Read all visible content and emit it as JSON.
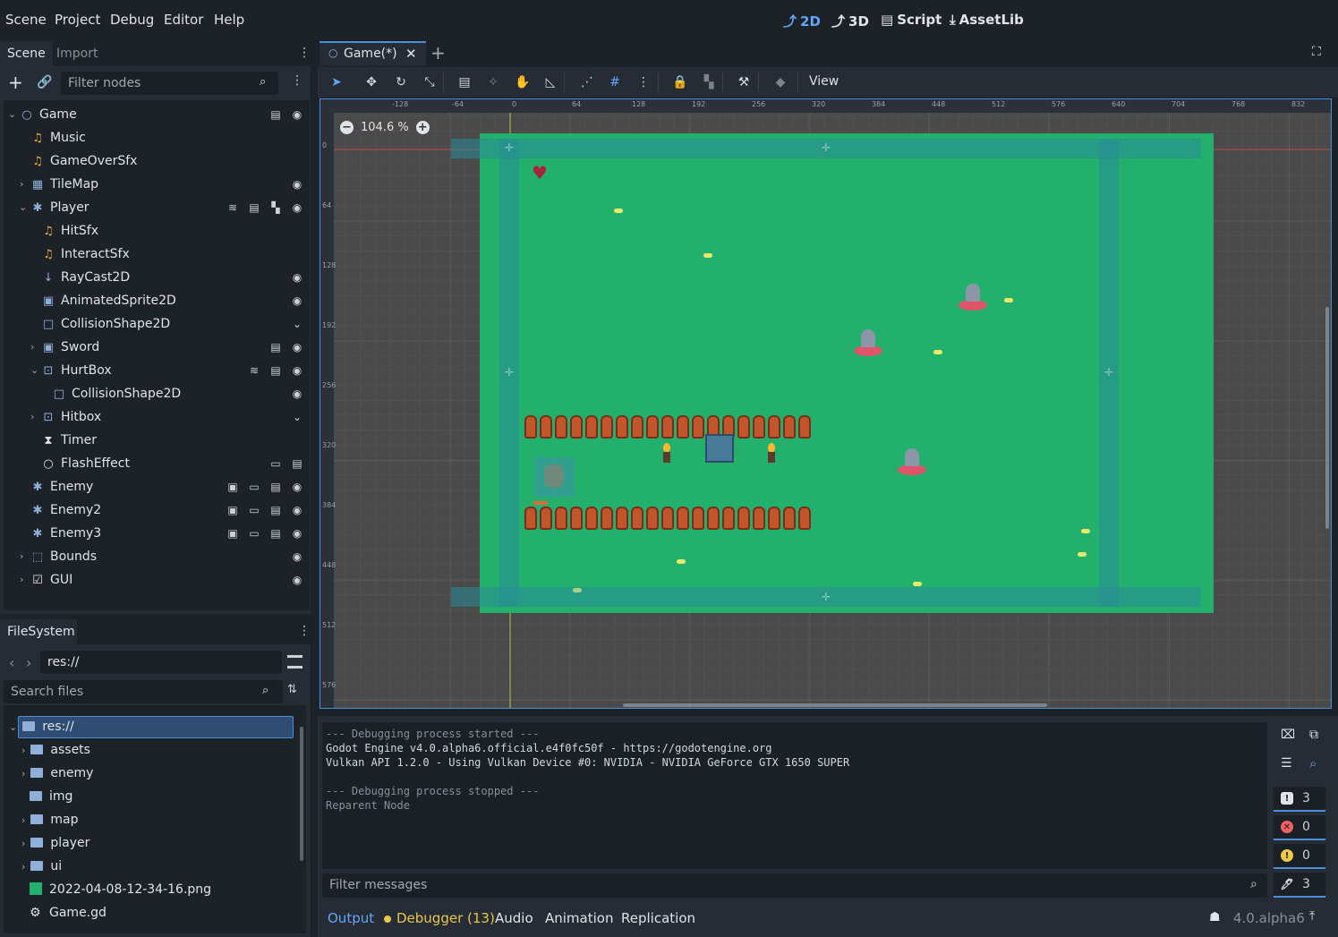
{
  "menu": [
    "Scene",
    "Project",
    "Debug",
    "Editor",
    "Help"
  ],
  "workspaces": {
    "2d": "2D",
    "3d": "3D",
    "script": "Script",
    "assetlib": "AssetLib"
  },
  "scene_dock": {
    "tabs": [
      "Scene",
      "Import"
    ],
    "filter_placeholder": "Filter nodes",
    "nodes": [
      {
        "label": "Game",
        "icon": "node2d-icon"
      },
      {
        "label": "Music",
        "icon": "audio-icon"
      },
      {
        "label": "GameOverSfx",
        "icon": "audio-icon"
      },
      {
        "label": "TileMap",
        "icon": "tilemap-icon"
      },
      {
        "label": "Player",
        "icon": "character-icon"
      },
      {
        "label": "HitSfx",
        "icon": "audio-icon"
      },
      {
        "label": "InteractSfx",
        "icon": "audio-icon"
      },
      {
        "label": "RayCast2D",
        "icon": "raycast-icon"
      },
      {
        "label": "AnimatedSprite2D",
        "icon": "sprite-icon"
      },
      {
        "label": "CollisionShape2D",
        "icon": "collision-icon"
      },
      {
        "label": "Sword",
        "icon": "sprite-icon"
      },
      {
        "label": "HurtBox",
        "icon": "area-icon"
      },
      {
        "label": "CollisionShape2D",
        "icon": "collision-icon"
      },
      {
        "label": "Hitbox",
        "icon": "area-icon"
      },
      {
        "label": "Timer",
        "icon": "timer-icon"
      },
      {
        "label": "FlashEffect",
        "icon": "node-icon"
      },
      {
        "label": "Enemy",
        "icon": "character-icon"
      },
      {
        "label": "Enemy2",
        "icon": "character-icon"
      },
      {
        "label": "Enemy3",
        "icon": "character-icon"
      },
      {
        "label": "Bounds",
        "icon": "control-icon"
      },
      {
        "label": "GUI",
        "icon": "canvas-icon"
      }
    ]
  },
  "filesystem": {
    "tab": "FileSystem",
    "path": "res://",
    "search_placeholder": "Search files",
    "items": [
      {
        "label": "res://"
      },
      {
        "label": "assets"
      },
      {
        "label": "enemy"
      },
      {
        "label": "img"
      },
      {
        "label": "map"
      },
      {
        "label": "player"
      },
      {
        "label": "ui"
      },
      {
        "label": "2022-04-08-12-34-16.png"
      },
      {
        "label": "Game.gd"
      }
    ]
  },
  "editor_tab": "Game(*)",
  "toolbar": {
    "view": "View"
  },
  "zoom": "104.6 %",
  "rulers": {
    "top": [
      "-128",
      "-64",
      "0",
      "64",
      "128",
      "192",
      "256",
      "320",
      "384",
      "448",
      "512",
      "576",
      "640",
      "704",
      "768",
      "832"
    ],
    "left": [
      "0",
      "64",
      "128",
      "192",
      "256",
      "320",
      "384",
      "448",
      "512",
      "576"
    ]
  },
  "output": {
    "lines": [
      "--- Debugging process started ---",
      "Godot Engine v4.0.alpha6.official.e4f0fc50f - https://godotengine.org",
      "Vulkan API 1.2.0 - Using Vulkan Device #0: NVIDIA - NVIDIA GeForce GTX 1650 SUPER",
      "",
      "--- Debugging process stopped ---",
      "Reparent Node"
    ],
    "filter_placeholder": "Filter messages",
    "counts": {
      "messages": "3",
      "errors": "0",
      "warnings": "0",
      "editor": "3"
    },
    "tabs": [
      "Output",
      "Debugger (13)",
      "Audio",
      "Animation",
      "Replication"
    ],
    "version": "4.0.alpha6"
  },
  "colors": {
    "accent": "#4b90d6",
    "map": "#23b06d",
    "debug_dot": "#e8c74a"
  }
}
